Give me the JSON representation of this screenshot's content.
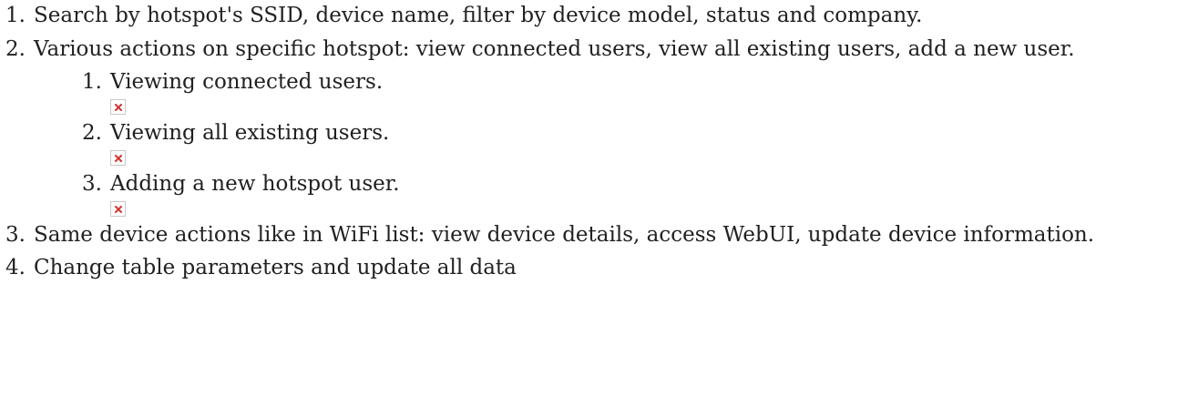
{
  "list": {
    "items": [
      {
        "number": "1.",
        "text": "Search by hotspot's SSID, device name, filter by device model, status and company."
      },
      {
        "number": "2.",
        "text": "Various actions on specific hotspot: view connected users, view all existing users, add a new user.",
        "subitems": [
          {
            "number": "1.",
            "text": "Viewing connected users.",
            "image": "broken-image-icon"
          },
          {
            "number": "2.",
            "text": "Viewing all existing users.",
            "image": "broken-image-icon"
          },
          {
            "number": "3.",
            "text": "Adding a new hotspot user.",
            "image": "broken-image-icon"
          }
        ]
      },
      {
        "number": "3.",
        "text": "Same device actions like in WiFi list: view device details, access WebUI, update device information."
      },
      {
        "number": "4.",
        "text": "Change table parameters and update all data"
      }
    ]
  },
  "colors": {
    "text": "#202122",
    "broken_image_mark": "#d33333",
    "broken_image_border": "#c8c8c8"
  }
}
